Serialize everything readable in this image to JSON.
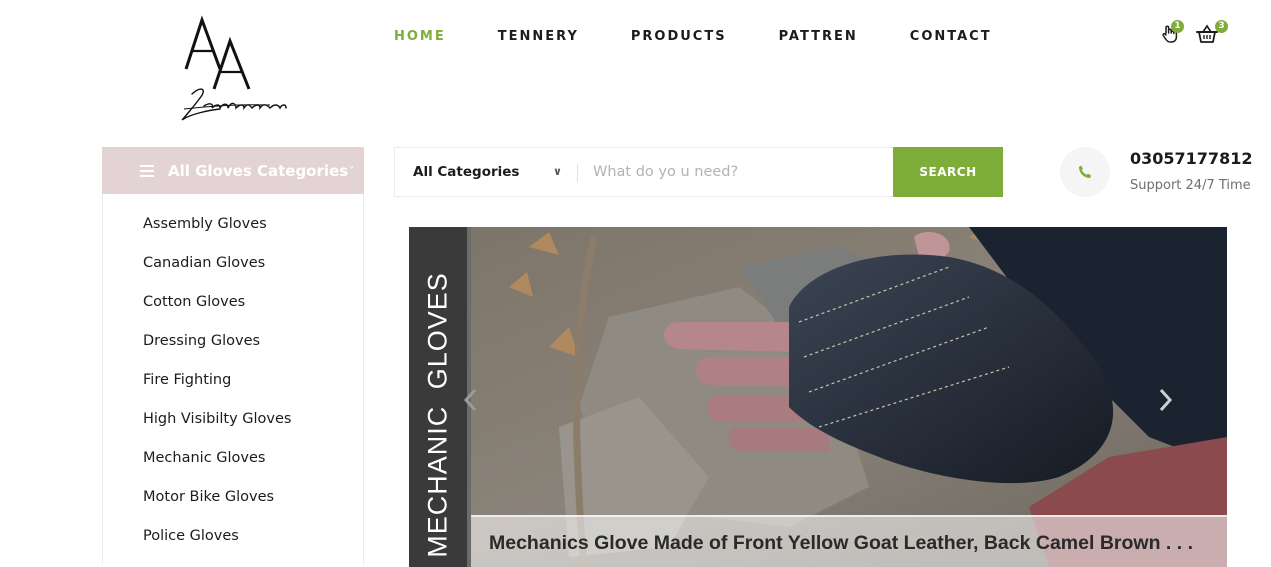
{
  "brand": {
    "logo_letters": "AA",
    "logo_script": "Enterprises"
  },
  "nav": [
    {
      "label": "HOME"
    },
    {
      "label": "TENNERY"
    },
    {
      "label": "PRODUCTS"
    },
    {
      "label": "PATTREN"
    },
    {
      "label": "CONTACT"
    }
  ],
  "header_icons": {
    "wishlist": {
      "icon": "hand-pointer-icon",
      "count": "1"
    },
    "cart": {
      "icon": "basket-icon",
      "count": "3"
    }
  },
  "categories": {
    "title": "All Gloves Categories",
    "items": [
      {
        "label": "Assembly Gloves"
      },
      {
        "label": "Canadian Gloves"
      },
      {
        "label": "Cotton Gloves"
      },
      {
        "label": "Dressing Gloves"
      },
      {
        "label": "Fire Fighting"
      },
      {
        "label": "High Visibilty Gloves"
      },
      {
        "label": "Mechanic Gloves"
      },
      {
        "label": "Motor Bike Gloves"
      },
      {
        "label": "Police Gloves"
      }
    ]
  },
  "search": {
    "category_selected": "All Categories",
    "placeholder": "What do yo u need?",
    "button_label": "SEARCH"
  },
  "contact": {
    "phone": "03057177812",
    "support": "Support 24/7 Time"
  },
  "hero": {
    "strip_label": "MECHANIC GLOVES",
    "caption": "Mechanics Glove Made of Front Yellow Goat Leather, Back Camel Brown . . ."
  },
  "colors": {
    "accent": "#7fad39",
    "category_header": "#e3d3d5",
    "strip": "#3a3a3a"
  }
}
